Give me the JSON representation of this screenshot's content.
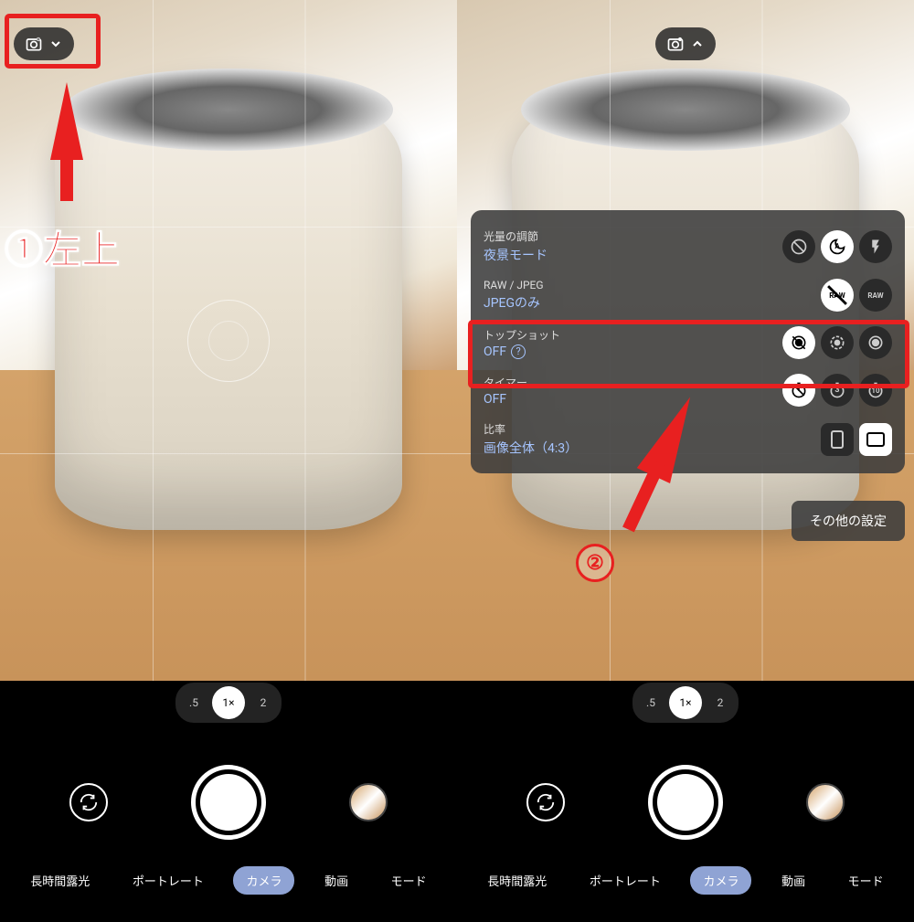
{
  "zoom": {
    "levels": [
      ".5",
      "1×",
      "2"
    ],
    "active": 1
  },
  "modes": [
    "長時間露光",
    "ポートレート",
    "カメラ",
    "動画",
    "モード"
  ],
  "active_mode": 2,
  "annotations": {
    "step1": "①左上",
    "step2": "②"
  },
  "panel": {
    "rows": [
      {
        "label": "光量の調節",
        "value": "夜景モード"
      },
      {
        "label": "RAW / JPEG",
        "value": "JPEGのみ"
      },
      {
        "label": "トップショット",
        "value": "OFF",
        "help": "?"
      },
      {
        "label": "タイマー",
        "value": "OFF"
      },
      {
        "label": "比率",
        "value": "画像全体（4:3）"
      }
    ],
    "opt_icons": {
      "exposure": [
        "off",
        "auto",
        "flash"
      ],
      "raw": [
        "jpeg",
        "raw"
      ],
      "topshot": [
        "off",
        "auto",
        "on"
      ],
      "timer": [
        "off",
        "3",
        "10"
      ],
      "ratio": [
        "3:4",
        "4:3"
      ]
    },
    "more": "その他の設定"
  },
  "icons": {
    "raw_text": "RAW"
  }
}
